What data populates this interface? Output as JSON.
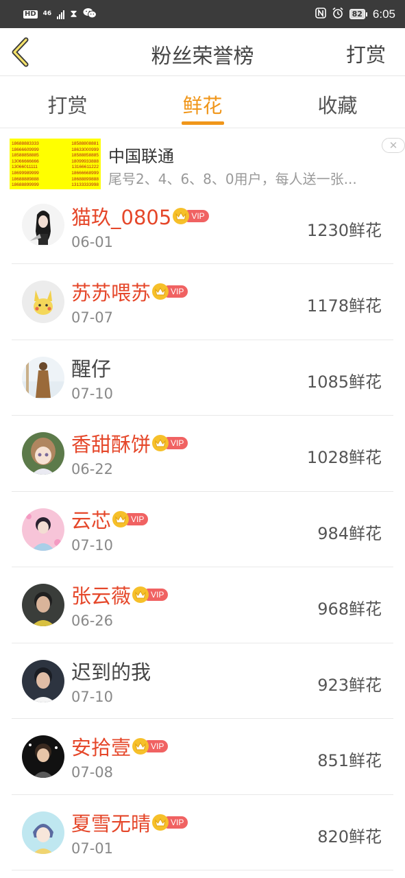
{
  "status_bar": {
    "hd": "HD",
    "network": "46",
    "battery": "82",
    "time": "6:05",
    "icons": [
      "hd-icon",
      "signal-icon",
      "hourglass-icon",
      "wechat-icon",
      "nfc-icon",
      "alarm-icon",
      "battery-icon"
    ]
  },
  "header": {
    "back_icon": "chevron-left-icon",
    "title": "粉丝荣誉榜",
    "action": "打赏"
  },
  "tabs": [
    {
      "label": "打赏",
      "active": false
    },
    {
      "label": "鲜花",
      "active": true
    },
    {
      "label": "收藏",
      "active": false
    }
  ],
  "ad": {
    "title": "中国联通",
    "description": "尾号2、4、6、8、0用户，每人送一张...",
    "close_icon": "close-icon",
    "image_numbers": [
      [
        "18688883333",
        "18588808881"
      ],
      [
        "18666609999",
        "18633000999"
      ],
      [
        "18588858885",
        "18588858885"
      ],
      [
        "13066666666",
        "18099933888"
      ],
      [
        "13066011111",
        "13166611222"
      ],
      [
        "18699989999",
        "18666668999"
      ],
      [
        "18688889888",
        "18688899888"
      ],
      [
        "18688899999",
        "13133333998"
      ]
    ]
  },
  "ranking": [
    {
      "name": "猫玖_0805",
      "vip": true,
      "date": "06-01",
      "amount": "1230鲜花"
    },
    {
      "name": "苏苏喂苏",
      "vip": true,
      "date": "07-07",
      "amount": "1178鲜花"
    },
    {
      "name": "醒仔",
      "vip": false,
      "date": "07-10",
      "amount": "1085鲜花"
    },
    {
      "name": "香甜酥饼",
      "vip": true,
      "date": "06-22",
      "amount": "1028鲜花"
    },
    {
      "name": "云芯",
      "vip": true,
      "date": "07-10",
      "amount": "984鲜花"
    },
    {
      "name": "张云薇",
      "vip": true,
      "date": "06-26",
      "amount": "968鲜花"
    },
    {
      "name": "迟到的我",
      "vip": false,
      "date": "07-10",
      "amount": "923鲜花"
    },
    {
      "name": "安拾壹",
      "vip": true,
      "date": "07-08",
      "amount": "851鲜花"
    },
    {
      "name": "夏雪无晴",
      "vip": true,
      "date": "07-01",
      "amount": "820鲜花"
    }
  ],
  "vip_label": "VIP",
  "colors": {
    "accent": "#f0961a",
    "vip_name": "#e5472a",
    "vip_tag": "#f06262",
    "crown": "#f6c02a",
    "status_bar": "#3b3b3b",
    "ad_background": "#ffff00"
  }
}
